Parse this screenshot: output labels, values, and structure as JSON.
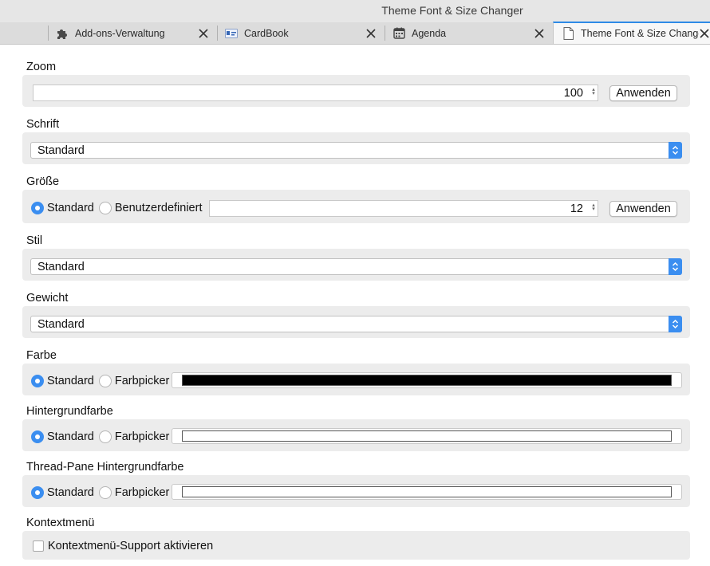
{
  "window": {
    "title": "Theme Font & Size Changer"
  },
  "tabs": [
    {
      "label": "Add-ons-Verwaltung",
      "icon": "puzzle-icon",
      "active": false
    },
    {
      "label": "CardBook",
      "icon": "cardbook-icon",
      "active": false
    },
    {
      "label": "Agenda",
      "icon": "calendar-icon",
      "active": false
    },
    {
      "label": "Theme Font & Size Changer",
      "icon": "document-icon",
      "active": true
    }
  ],
  "zoom": {
    "label": "Zoom",
    "value": "100",
    "apply_label": "Anwenden"
  },
  "font": {
    "label": "Schrift",
    "selected": "Standard"
  },
  "size": {
    "label": "Größe",
    "radio_default": "Standard",
    "radio_custom": "Benutzerdefiniert",
    "selected": "default",
    "value": "12",
    "apply_label": "Anwenden"
  },
  "style": {
    "label": "Stil",
    "selected": "Standard"
  },
  "weight": {
    "label": "Gewicht",
    "selected": "Standard"
  },
  "color": {
    "label": "Farbe",
    "radio_default": "Standard",
    "radio_picker": "Farbpicker",
    "selected": "default",
    "swatch": "#000000"
  },
  "background": {
    "label": "Hintergrundfarbe",
    "radio_default": "Standard",
    "radio_picker": "Farbpicker",
    "selected": "default",
    "swatch": "#ffffff"
  },
  "threadpane": {
    "label": "Thread-Pane Hintergrundfarbe",
    "radio_default": "Standard",
    "radio_picker": "Farbpicker",
    "selected": "default",
    "swatch": "#ffffff"
  },
  "contextmenu": {
    "label": "Kontextmenü",
    "checkbox_label": "Kontextmenü-Support aktivieren",
    "checked": false
  },
  "colors": {
    "accent": "#3b8ef0",
    "panel": "#ececec",
    "tab_active_border": "#2e8ae6"
  }
}
